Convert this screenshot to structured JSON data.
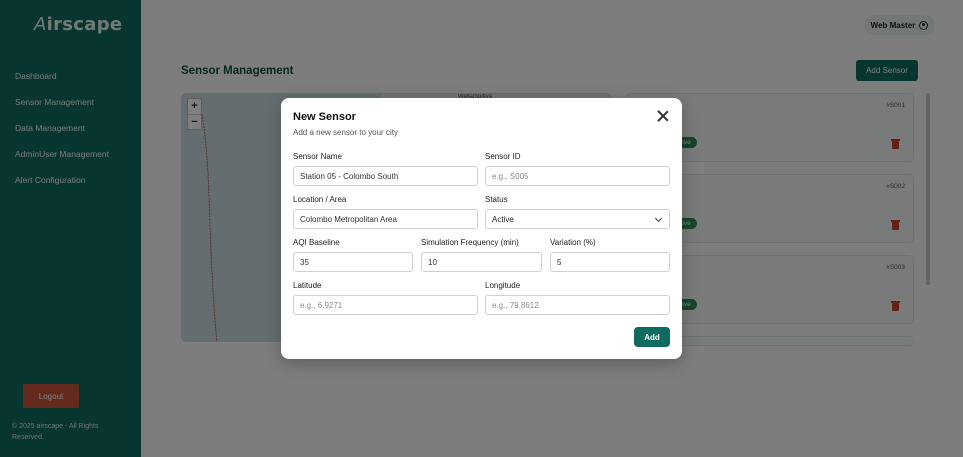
{
  "sidebar": {
    "brand": "irscape",
    "brand_mark": "A",
    "items": [
      {
        "label": "Dashboard"
      },
      {
        "label": "Sensor Management"
      },
      {
        "label": "Data Management"
      },
      {
        "label": "AdminUser Management"
      },
      {
        "label": "Alert Configuration"
      }
    ],
    "logout_label": "Logout",
    "copyright": "© 2025 airscape - All Rights Reserved."
  },
  "header": {
    "user_name": "Web Master",
    "page_title": "Sensor Management",
    "add_sensor_label": "Add Sensor"
  },
  "map": {
    "zoom_in": "+",
    "zoom_out": "−",
    "tile_label": "Wellampitiya"
  },
  "sensor_cards": [
    {
      "id": "#S001",
      "status": "Active"
    },
    {
      "id": "#S002",
      "status": "Active"
    },
    {
      "id": "#S003",
      "status": "Active"
    }
  ],
  "modal": {
    "title": "New Sensor",
    "subtitle": "Add a new sensor to your city",
    "fields": {
      "sensor_name": {
        "label": "Sensor Name",
        "value": "Station 05 - Colombo South"
      },
      "sensor_id": {
        "label": "Sensor ID",
        "placeholder": "e.g., S005"
      },
      "location": {
        "label": "Location / Area",
        "value": "Colombo Metropolitan Area"
      },
      "status": {
        "label": "Status",
        "value": "Active"
      },
      "aqi_baseline": {
        "label": "AQI Baseline",
        "value": "35"
      },
      "sim_frequency": {
        "label": "Simulation Frequency (min)",
        "value": "10"
      },
      "variation": {
        "label": "Variation (%)",
        "value": "5"
      },
      "latitude": {
        "label": "Latitude",
        "placeholder": "e.g., 6.9271"
      },
      "longitude": {
        "label": "Longitude",
        "placeholder": "e.g., 79.8612"
      }
    },
    "add_label": "Add"
  },
  "colors": {
    "brand_green": "#0f6b5f",
    "logout_red": "#c9543a",
    "status_green": "#2e8b57"
  }
}
